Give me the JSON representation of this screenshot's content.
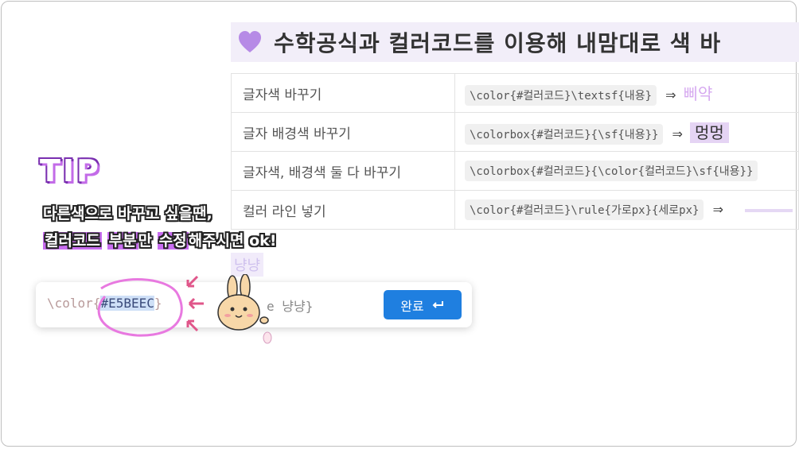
{
  "heading": {
    "title": "수학공식과 컬러코드를 이용해 내맘대로 색 바"
  },
  "table": {
    "rows": [
      {
        "label": "글자색 바꾸기",
        "code": "\\color{#컬러코드}\\textsf{내용}",
        "arrow": "⇒",
        "example": "삐약"
      },
      {
        "label": "글자 배경색 바꾸기",
        "code": "\\colorbox{#컬러코드}{\\sf{내용}}",
        "arrow": "⇒",
        "example": "멍멍"
      },
      {
        "label": "글자색, 배경색 둘 다 바꾸기",
        "code": "\\colorbox{#컬러코드}{\\color{컬러코드}\\sf{내용}}",
        "arrow": "",
        "example": ""
      },
      {
        "label": "컬러 라인 넣기",
        "code": "\\color{#컬러코드}\\rule{가로px}{세로px}",
        "arrow": "⇒",
        "example": ""
      }
    ]
  },
  "tip": {
    "title": "TIP",
    "line1": "다른색으로 바꾸고 싶을땐,",
    "line2_hl1": "컬러코드",
    "line2_sp1": " ",
    "line2_hl2": "부분",
    "line2_mid": "만 ",
    "line2_hl3": "수정",
    "line2_end": "해주시면 ok!"
  },
  "ghost_text": "냥냥",
  "input": {
    "prefix": "\\color{",
    "selected": "#E5BEEC",
    "suffix": "}",
    "tail": "e  냥냥}",
    "done_label": "완료"
  },
  "colors": {
    "heading_bg": "#f2eef9",
    "accent_purple": "#c86df0",
    "button_blue": "#1f7fe0",
    "selection": "#cfe0f7"
  },
  "icons": [
    "purple-heart-icon",
    "enter-icon",
    "bunny-sticker",
    "pink-arrow-icon"
  ]
}
